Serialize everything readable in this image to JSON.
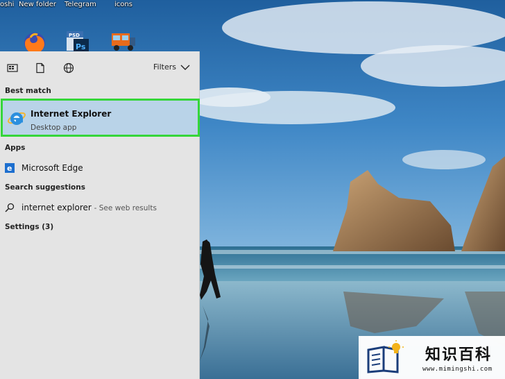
{
  "desktop": {
    "labels": [
      "oshi",
      "New folder",
      "Telegram",
      "icons"
    ],
    "icons": [
      "firefox-icon",
      "photoshop-icon",
      "truck-icon"
    ]
  },
  "panel": {
    "toolbar": {
      "icons": [
        "apps-view-icon",
        "document-icon",
        "globe-icon"
      ],
      "filters_label": "Filters"
    },
    "best_match": {
      "heading": "Best match",
      "title": "Internet Explorer",
      "subtitle": "Desktop app",
      "highlight_color": "#35d63a"
    },
    "apps": {
      "heading": "Apps",
      "items": [
        {
          "label": "Microsoft Edge",
          "icon": "edge-icon"
        }
      ]
    },
    "search_suggestions": {
      "heading": "Search suggestions",
      "items": [
        {
          "query": "internet explorer",
          "suffix": "- See web results",
          "icon": "search-icon"
        }
      ]
    },
    "settings": {
      "heading": "Settings (3)"
    }
  },
  "watermark": {
    "title": "知识百科",
    "url": "www.mimingshi.com"
  }
}
